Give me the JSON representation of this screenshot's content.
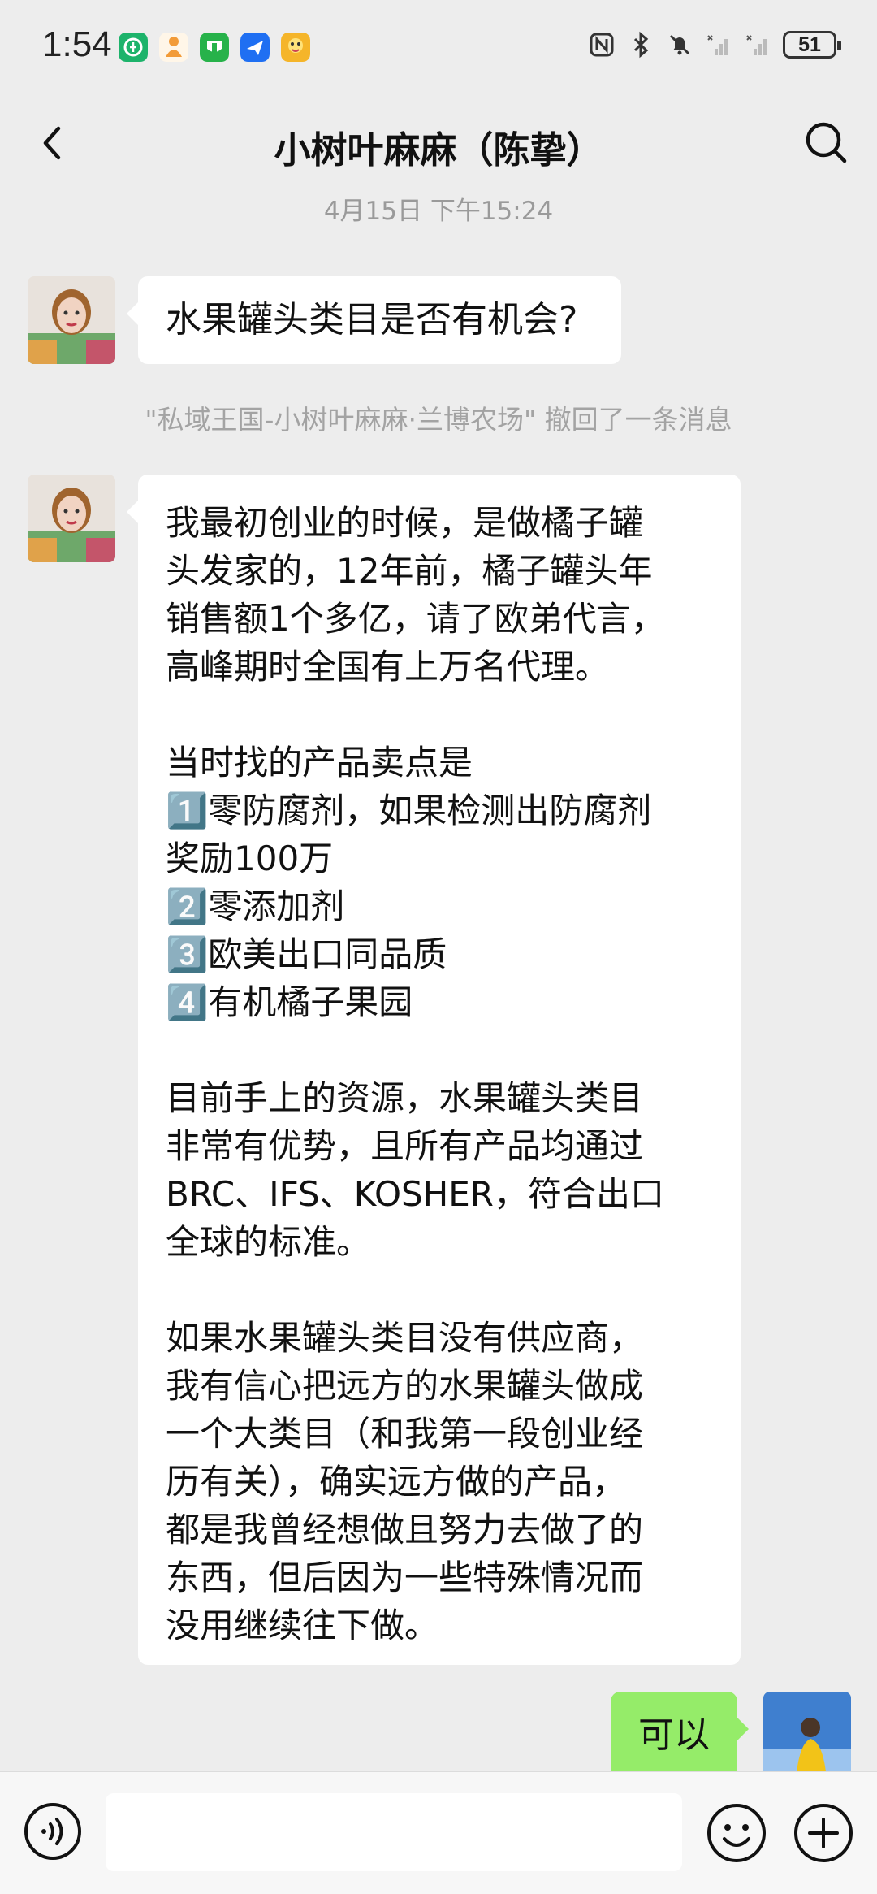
{
  "status_bar": {
    "time": "1:54",
    "battery": "51",
    "app_icons": [
      {
        "name": "green-circle-app-icon",
        "color": "#1db36b"
      },
      {
        "name": "orange-figure-app-icon",
        "color": "#f29b38"
      },
      {
        "name": "green-cart-app-icon",
        "color": "#27b24a"
      },
      {
        "name": "blue-plane-app-icon",
        "color": "#1f6ff2"
      },
      {
        "name": "yellow-duck-app-icon",
        "color": "#f5b52a"
      }
    ]
  },
  "header": {
    "title": "小树叶麻麻（陈挚）"
  },
  "chat": {
    "timestamp": "4月15日 下午15:24",
    "messages": [
      {
        "side": "left",
        "text": "水果罐头类目是否有机会?"
      },
      {
        "side": "left",
        "text": "我最初创业的时候，是做橘子罐\n头发家的，12年前，橘子罐头年\n销售额1个多亿，请了欧弟代言，\n高峰期时全国有上万名代理。\n\n当时找的产品卖点是\n1️⃣零防腐剂，如果检测出防腐剂\n奖励100万\n2️⃣零添加剂\n3️⃣欧美出口同品质\n4️⃣有机橘子果园\n\n目前手上的资源，水果罐头类目\n非常有优势，且所有产品均通过\nBRC、IFS、KOSHER，符合出口\n全球的标准。\n\n如果水果罐头类目没有供应商，\n我有信心把远方的水果罐头做成\n一个大类目（和我第一段创业经\n历有关），确实远方做的产品，\n都是我曾经想做且努力去做了的\n东西，但后因为一些特殊情况而\n没用继续往下做。"
      },
      {
        "side": "right",
        "text": "可以"
      }
    ],
    "recall_notice": "\"私域王国-小树叶麻麻·兰博农场\" 撤回了一条消息"
  },
  "input_bar": {
    "placeholder": ""
  },
  "colors": {
    "background": "#ededed",
    "bubble_left": "#ffffff",
    "bubble_right": "#95ec69"
  }
}
